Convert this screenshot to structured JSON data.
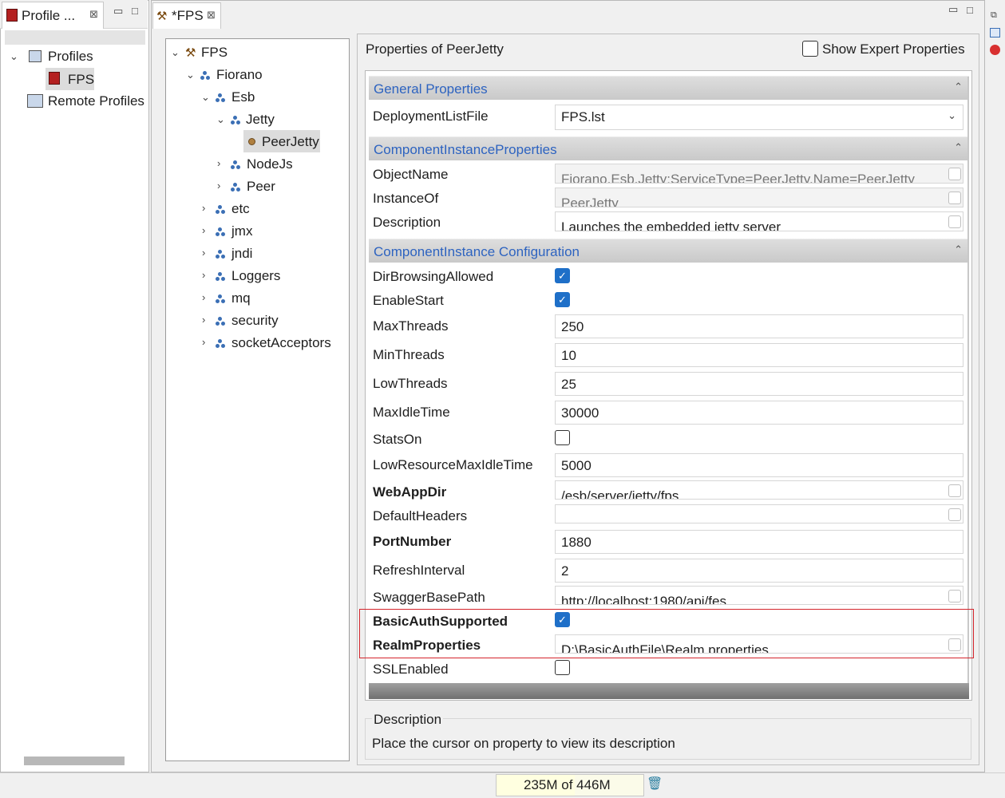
{
  "left_view": {
    "tab_label": "Profile ...",
    "close": "⊠",
    "minimize": "▭",
    "maximize": "□",
    "tree": [
      {
        "label": "Profiles",
        "expanded": true
      },
      {
        "label": "FPS",
        "selected": true
      },
      {
        "label": "Remote Profiles"
      }
    ]
  },
  "editor": {
    "tab_label": "*FPS",
    "close": "⊠",
    "minimize": "▭",
    "maximize": "□",
    "tree": [
      {
        "label": "FPS"
      },
      {
        "label": "Fiorano"
      },
      {
        "label": "Esb"
      },
      {
        "label": "Jetty"
      },
      {
        "label": "PeerJetty",
        "selected": true
      },
      {
        "label": "NodeJs"
      },
      {
        "label": "Peer"
      },
      {
        "label": "etc"
      },
      {
        "label": "jmx"
      },
      {
        "label": "jndi"
      },
      {
        "label": "Loggers"
      },
      {
        "label": "mq"
      },
      {
        "label": "security"
      },
      {
        "label": "socketAcceptors"
      }
    ]
  },
  "properties": {
    "title": "Properties of PeerJetty",
    "show_expert_label": "Show Expert Properties",
    "show_expert_checked": false,
    "sections": {
      "general": {
        "title": "General Properties",
        "rows": [
          {
            "name": "DeploymentListFile",
            "value": "FPS.lst"
          }
        ]
      },
      "instance": {
        "title": "ComponentInstanceProperties",
        "rows": [
          {
            "name": "ObjectName",
            "value": "Fiorano.Esb.Jetty:ServiceType=PeerJetty,Name=PeerJetty"
          },
          {
            "name": "InstanceOf",
            "value": "PeerJetty"
          },
          {
            "name": "Description",
            "value": "Launches the embedded jetty server"
          }
        ]
      },
      "config": {
        "title": "ComponentInstance Configuration",
        "rows": [
          {
            "name": "DirBrowsingAllowed",
            "checked": true
          },
          {
            "name": "EnableStart",
            "checked": true
          },
          {
            "name": "MaxThreads",
            "value": "250"
          },
          {
            "name": "MinThreads",
            "value": "10"
          },
          {
            "name": "LowThreads",
            "value": "25"
          },
          {
            "name": "MaxIdleTime",
            "value": "30000"
          },
          {
            "name": "StatsOn",
            "checked": false
          },
          {
            "name": "LowResourceMaxIdleTime",
            "value": "5000"
          },
          {
            "name": "WebAppDir",
            "value": "/esb/server/jetty/fps"
          },
          {
            "name": "DefaultHeaders",
            "value": ""
          },
          {
            "name": "PortNumber",
            "value": "1880"
          },
          {
            "name": "RefreshInterval",
            "value": "2"
          },
          {
            "name": "SwaggerBasePath",
            "value": "http://localhost:1980/api/fes"
          },
          {
            "name": "BasicAuthSupported",
            "checked": true
          },
          {
            "name": "RealmProperties",
            "value": "D:\\BasicAuthFile\\Realm.properties"
          },
          {
            "name": "SSLEnabled",
            "checked": false
          }
        ]
      }
    },
    "description": {
      "title": "Description",
      "text": "Place the cursor on property to view its description"
    }
  },
  "status": {
    "heap": "235M of 446M",
    "heap_used_fraction": 0.53
  },
  "colors": {
    "section_title": "#2d63c0",
    "checkbox_on": "#1e6fc8",
    "highlight_border": "#d4242b"
  }
}
